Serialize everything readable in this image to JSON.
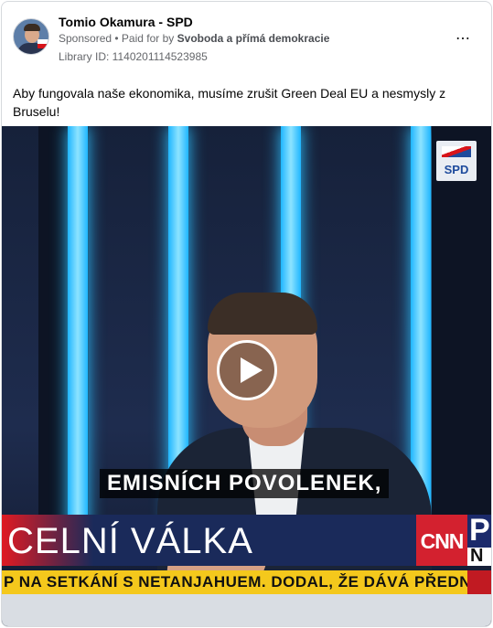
{
  "post": {
    "author": "Tomio Okamura - SPD",
    "sponsored": "Sponsored",
    "paid_for_prefix": "• Paid for by",
    "payer": "Svoboda a přímá demokracie",
    "library_id": "Library ID: 1140201114523985",
    "more_icon": "⋯",
    "text": "Aby fungovala naše ekonomika, musíme zrušit Green Deal EU a nesmysly z Bruselu!"
  },
  "video": {
    "channel_logo": "SPD",
    "subtitle": "EMISNÍCH POVOLENEK,",
    "ticker_headline": "CELNÍ VÁLKA",
    "network_logo": "CNN",
    "network_letter_top": "P",
    "network_letter_bottom": "N",
    "news_crawl": "P NA SETKÁNÍ S NETANJAHUEM. DODAL, ŽE DÁVÁ PŘEDNOST UZAV",
    "play_icon": "play-icon"
  },
  "colors": {
    "accent_red": "#e01a22",
    "ticker_blue": "#1a2a5a",
    "crawl_yellow": "#f4c81c",
    "studio_light": "#1fb6ff"
  }
}
